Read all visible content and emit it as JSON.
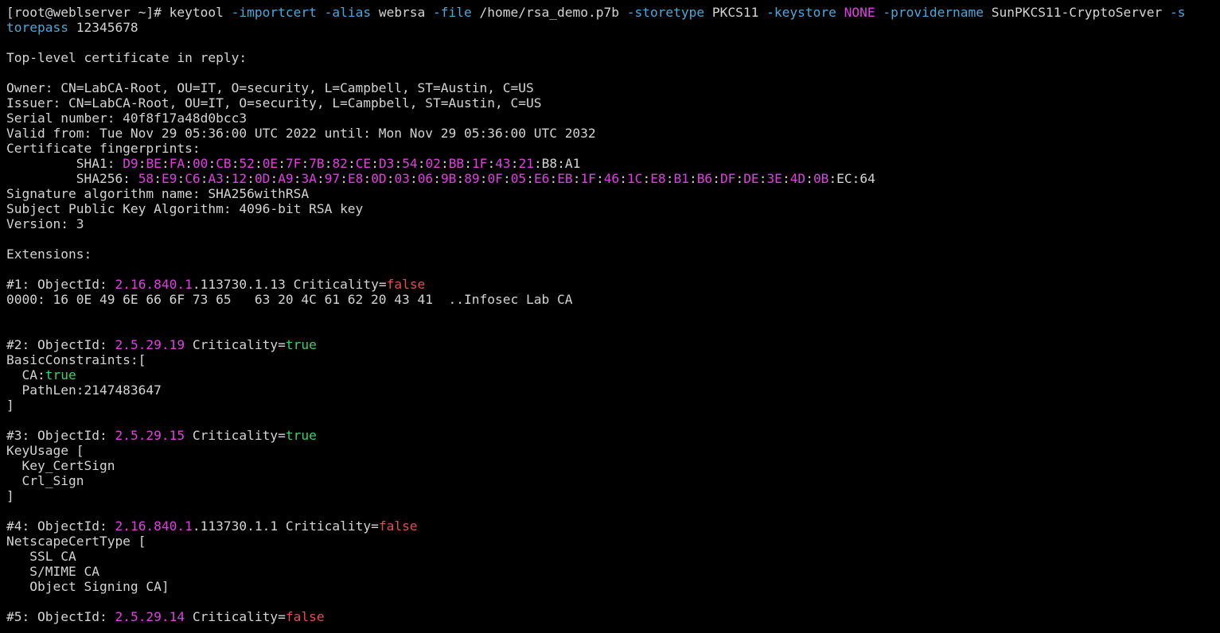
{
  "terminal": {
    "prompt": "[root@weblserver ~]# ",
    "command": {
      "cmd": "keytool ",
      "opt_importcert": "-importcert",
      "opt_alias": "-alias",
      "alias_val": " webrsa ",
      "opt_file": "-file",
      "file_val": " /home/rsa_demo.p7b ",
      "opt_storetype": "-storetype",
      "storetype_val": " PKCS11 ",
      "opt_keystore": "-keystore",
      "keystore_val": "NONE",
      "opt_providername": "-providername",
      "providername_val": " SunPKCS11-CryptoServer ",
      "opt_storepass_a": "-s",
      "opt_storepass_b": "torepass",
      "storepass_val": " 12345678"
    },
    "top_level": "Top-level certificate in reply:",
    "owner": "Owner: CN=LabCA-Root, OU=IT, O=security, L=Campbell, ST=Austin, C=US",
    "issuer": "Issuer: CN=LabCA-Root, OU=IT, O=security, L=Campbell, ST=Austin, C=US",
    "serial": "Serial number: 40f8f17a48d0bcc3",
    "valid": "Valid from: Tue Nov 29 05:36:00 UTC 2022 until: Mon Nov 29 05:36:00 UTC 2032",
    "fingerprints_label": "Certificate fingerprints:",
    "sha1_label": "         SHA1: ",
    "sha1_colored": [
      "D9",
      "BE",
      "FA",
      "00",
      "CB",
      "52",
      "0E",
      "7F",
      "7B",
      "82",
      "CE",
      "D3",
      "54",
      "02",
      "BB",
      "1F",
      "43",
      "21"
    ],
    "sha1_tail": ":B8:A1",
    "sha256_label": "         SHA256: ",
    "sha256_colored": [
      "58",
      "E9",
      "C6",
      "A3",
      "12",
      "0D",
      "A9",
      "3A",
      "97",
      "E8",
      "0D",
      "03",
      "06",
      "9B",
      "89",
      "0F",
      "05",
      "E6",
      "EB",
      "1F",
      "46",
      "1C",
      "E8",
      "B1",
      "B6",
      "DF",
      "DE",
      "3E",
      "4D",
      "0B"
    ],
    "sha256_tail": ":EC:64",
    "sig_alg": "Signature algorithm name: SHA256withRSA",
    "pubkey_alg": "Subject Public Key Algorithm: 4096-bit RSA key",
    "version": "Version: 3",
    "extensions_label": "Extensions:",
    "ext1": {
      "prefix": "#1: ObjectId: ",
      "oid_colored": "2.16.840.1",
      "oid_rest": ".113730.1.13",
      "crit_label": " Criticality=",
      "crit_val": "false",
      "dump": "0000: 16 0E 49 6E 66 6F 73 65   63 20 4C 61 62 20 43 41  ..Infosec Lab CA"
    },
    "ext2": {
      "prefix": "#2: ObjectId: ",
      "oid_colored": "2.5.29.19",
      "crit_label": " Criticality=",
      "crit_val": "true",
      "l1": "BasicConstraints:[",
      "ca_label": "  CA:",
      "ca_val": "true",
      "pathlen": "  PathLen:2147483647",
      "close": "]"
    },
    "ext3": {
      "prefix": "#3: ObjectId: ",
      "oid_colored": "2.5.29.15",
      "crit_label": " Criticality=",
      "crit_val": "true",
      "l1": "KeyUsage [",
      "l2": "  Key_CertSign",
      "l3": "  Crl_Sign",
      "close": "]"
    },
    "ext4": {
      "prefix": "#4: ObjectId: ",
      "oid_colored": "2.16.840.1",
      "oid_rest": ".113730.1.1",
      "crit_label": " Criticality=",
      "crit_val": "false",
      "l1": "NetscapeCertType [",
      "l2": "   SSL CA",
      "l3": "   S/MIME CA",
      "l4": "   Object Signing CA]"
    },
    "ext5": {
      "prefix": "#5: ObjectId: ",
      "oid_colored": "2.5.29.14",
      "crit_label": " Criticality=",
      "crit_val": "false"
    }
  },
  "colors": {
    "background": "#000000",
    "text": "#d4d4d4",
    "option": "#4fa6d8",
    "hex": "#e040e0",
    "true": "#3ad06a",
    "false": "#e05050"
  }
}
